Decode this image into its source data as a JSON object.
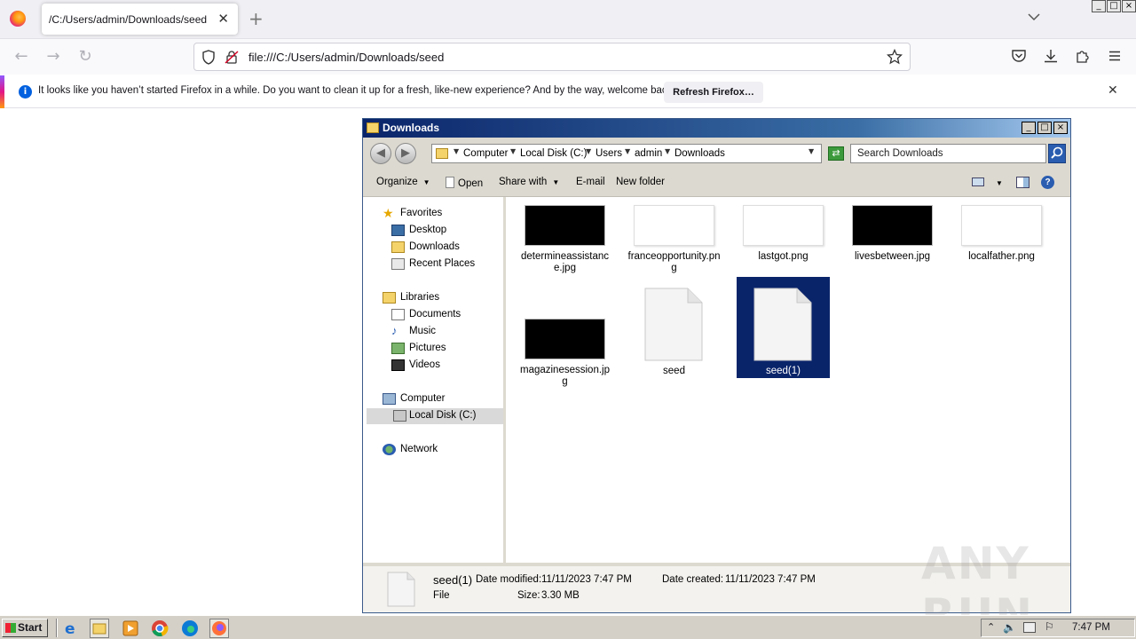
{
  "browser": {
    "tab_title": "/C:/Users/admin/Downloads/seed",
    "url": "file:///C:/Users/admin/Downloads/seed",
    "window_buttons": [
      "_",
      "□",
      "×"
    ]
  },
  "notification": {
    "message": "It looks like you haven’t started Firefox in a while. Do you want to clean it up for a fresh, like-new experience? And by the way, welcome back!",
    "button": "Refresh Firefox…"
  },
  "explorer": {
    "title": "Downloads",
    "breadcrumb": [
      "Computer",
      "Local Disk (C:)",
      "Users",
      "admin",
      "Downloads"
    ],
    "search_placeholder": "Search Downloads",
    "commands": {
      "organize": "Organize",
      "open": "Open",
      "share_with": "Share with",
      "email": "E-mail",
      "new_folder": "New folder"
    },
    "nav": {
      "favorites": "Favorites",
      "desktop": "Desktop",
      "downloads": "Downloads",
      "recent_places": "Recent Places",
      "libraries": "Libraries",
      "documents": "Documents",
      "music": "Music",
      "pictures": "Pictures",
      "videos": "Videos",
      "computer": "Computer",
      "local_disk": "Local Disk (C:)",
      "network": "Network"
    },
    "files": [
      {
        "name": "determineassistance.jpg",
        "thumb": "black"
      },
      {
        "name": "franceopportunity.png",
        "thumb": "white"
      },
      {
        "name": "lastgot.png",
        "thumb": "white"
      },
      {
        "name": "livesbetween.jpg",
        "thumb": "black"
      },
      {
        "name": "localfather.png",
        "thumb": "white"
      },
      {
        "name": "magazinesession.jpg",
        "thumb": "black"
      },
      {
        "name": "seed",
        "thumb": "document"
      },
      {
        "name": "seed(1)",
        "thumb": "document",
        "selected": true
      }
    ],
    "details": {
      "name": "seed(1)",
      "modified_label": "Date modified:",
      "modified": "11/11/2023 7:47 PM",
      "created_label": "Date created:",
      "created": "11/11/2023 7:47 PM",
      "type": "File",
      "size_label": "Size:",
      "size": "3.30 MB"
    }
  },
  "watermark": "ANY RUN",
  "taskbar": {
    "start": "Start",
    "clock": "7:47 PM"
  },
  "colors": {
    "selection": "#0a246a",
    "firefox_accent": "#0060df",
    "title_bar": "#0a246a"
  }
}
